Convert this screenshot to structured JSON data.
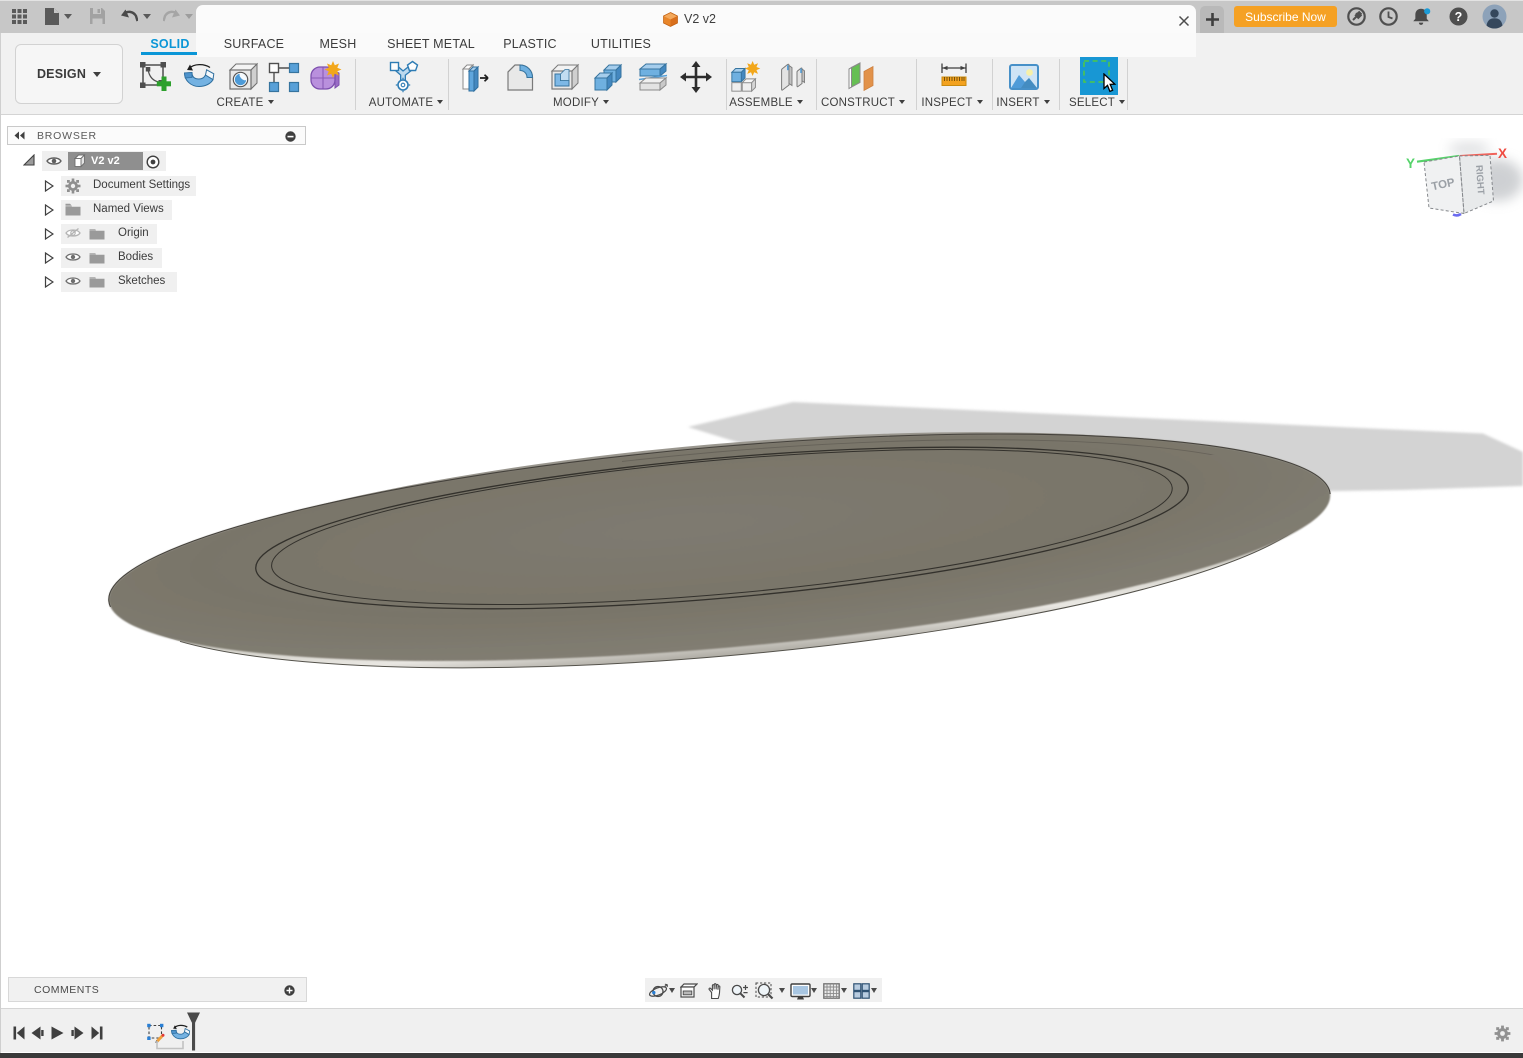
{
  "titlebar": {
    "doc_tab": {
      "title": "V2 v2",
      "close_label": "×"
    },
    "new_tab_label": "+",
    "subscribe_button": {
      "label": "Subscribe Now",
      "color": "#f5a124"
    },
    "status_icons": [
      "extensions",
      "job-status",
      "notifications",
      "help",
      "account"
    ],
    "help_glyph": "?",
    "notification_dot_color": "#1b9bd7"
  },
  "ribbon": {
    "workspace_selector": {
      "label": "DESIGN"
    },
    "active_tab_color": "#0a96d7",
    "tabs": [
      {
        "label": "SOLID",
        "active": true
      },
      {
        "label": "SURFACE",
        "active": false
      },
      {
        "label": "MESH",
        "active": false
      },
      {
        "label": "SHEET METAL",
        "active": false
      },
      {
        "label": "PLASTIC",
        "active": false
      },
      {
        "label": "UTILITIES",
        "active": false
      }
    ],
    "groups": [
      {
        "label": "CREATE",
        "tools": [
          "create-sketch",
          "revolve",
          "hole",
          "rectangular-pattern",
          "create-form"
        ]
      },
      {
        "label": "AUTOMATE",
        "tools": [
          "automate"
        ]
      },
      {
        "label": "MODIFY",
        "tools": [
          "press-pull",
          "fillet",
          "shell",
          "combine",
          "split-body",
          "move-copy"
        ]
      },
      {
        "label": "ASSEMBLE",
        "tools": [
          "new-component",
          "joint"
        ]
      },
      {
        "label": "CONSTRUCT",
        "tools": [
          "construct-plane"
        ]
      },
      {
        "label": "INSPECT",
        "tools": [
          "measure"
        ]
      },
      {
        "label": "INSERT",
        "tools": [
          "insert-image"
        ]
      },
      {
        "label": "SELECT",
        "tools": [
          "select"
        ]
      }
    ]
  },
  "browser": {
    "header": {
      "label": "BROWSER"
    },
    "root": {
      "label": "V2 v2",
      "selected": true
    },
    "rows": [
      {
        "label": "Document Settings",
        "icon": "gear",
        "eye": null
      },
      {
        "label": "Named Views",
        "icon": "folder",
        "eye": null
      },
      {
        "label": "Origin",
        "icon": "folder",
        "eye": "hidden"
      },
      {
        "label": "Bodies",
        "icon": "folder",
        "eye": "visible"
      },
      {
        "label": "Sketches",
        "icon": "folder",
        "eye": "visible"
      }
    ]
  },
  "viewcube": {
    "faces": {
      "top": "TOP",
      "right": "RIGHT"
    },
    "axes": {
      "x": "X",
      "y": "Y"
    },
    "colors": {
      "x": "#ef4b41",
      "y": "#55d36a",
      "z": "#6b6bf0"
    }
  },
  "canvas": {
    "background": "#ffffff",
    "shadow_color": "#d3d3d3",
    "body_top_color": "#7b776d",
    "body_edge_color": "#8f8b81",
    "underside_color": "#d5d3cc"
  },
  "comments": {
    "label": "COMMENTS"
  },
  "navbar": {
    "tools": [
      "orbit",
      "look-at",
      "pan",
      "zoom",
      "fit",
      "display-settings",
      "grid-settings",
      "viewports"
    ]
  },
  "timeline": {
    "controls": [
      "go-to-start",
      "step-back",
      "play",
      "step-forward",
      "go-to-end"
    ],
    "features": [
      "sketch",
      "revolve"
    ]
  }
}
